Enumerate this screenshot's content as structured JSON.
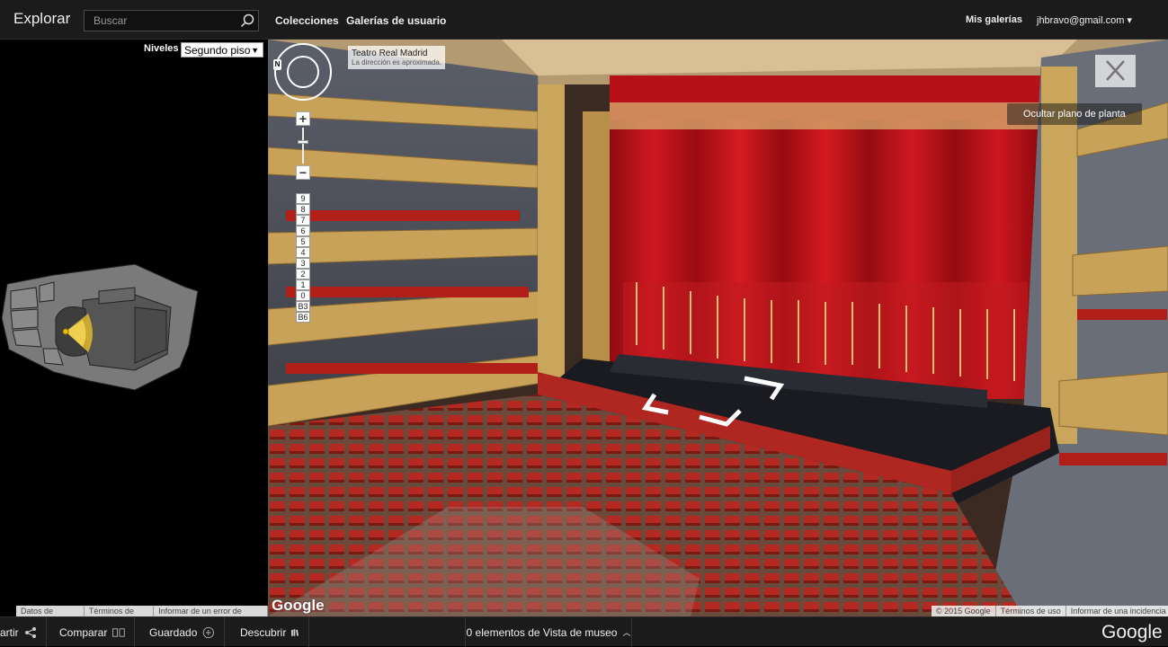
{
  "topbar": {
    "brand": "Explorar",
    "search_placeholder": "Buscar",
    "nav": {
      "collections": "Colecciones",
      "user_galleries": "Galerías de usuario"
    },
    "my_galleries": "Mis galerías",
    "account": "jhbravo@gmail.com ▾"
  },
  "left_panel": {
    "levels_label": "Niveles",
    "levels_selected": "Segundo piso",
    "map_footer": [
      "Datos de mapas",
      "Términos de uso",
      "Informar de un error de Maps"
    ]
  },
  "pano": {
    "place_title": "Teatro Real Madrid",
    "place_subtitle": "La dirección es aproximada.",
    "compass_north": "N",
    "zoom_in": "+",
    "zoom_out": "−",
    "floors": [
      "9",
      "8",
      "7",
      "6",
      "5",
      "4",
      "3",
      "2",
      "1",
      "0",
      "B3",
      "B6"
    ],
    "close_symbol": "✕",
    "hide_plan": "Ocultar plano de planta",
    "google_watermark": "Google",
    "footer": [
      "© 2015 Google",
      "Términos de uso",
      "Informar de una incidencia"
    ]
  },
  "bottombar": {
    "share": "artir",
    "compare": "Comparar",
    "saved": "Guardado",
    "discover": "Descubrir",
    "items": "0 elementos de Vista de museo",
    "google": "Google"
  },
  "colors": {
    "bar_bg": "#1b1b1b",
    "curtain": "#c0121a",
    "gold": "#c9a25a",
    "seat": "#a8241c"
  }
}
